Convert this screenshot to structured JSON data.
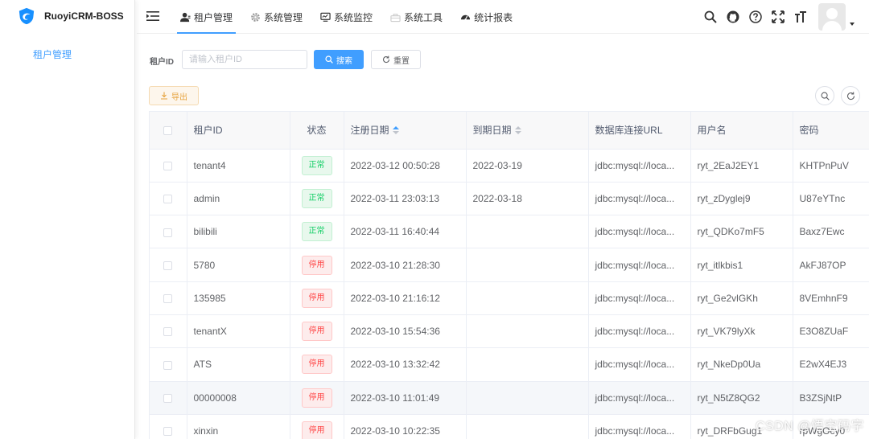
{
  "app": {
    "title": "RuoyiCRM-BOSS",
    "brand_color": "#409eff"
  },
  "sidebar": {
    "items": [
      {
        "label": "租户管理",
        "active": true
      }
    ]
  },
  "topnav": {
    "items": [
      {
        "label": "租户管理",
        "icon": "user-icon",
        "active": true
      },
      {
        "label": "系统管理",
        "icon": "gear-icon",
        "active": false
      },
      {
        "label": "系统监控",
        "icon": "monitor-icon",
        "active": false
      },
      {
        "label": "系统工具",
        "icon": "toolbox-icon",
        "active": false
      },
      {
        "label": "统计报表",
        "icon": "dashboard-icon",
        "active": false
      }
    ],
    "tools": [
      "search-icon",
      "github-icon",
      "question-icon",
      "fullscreen-icon",
      "font-size-icon"
    ]
  },
  "search": {
    "label": "租户ID",
    "placeholder": "请输入租户ID",
    "value": "",
    "search_label": "搜索",
    "reset_label": "重置"
  },
  "toolbar": {
    "export_label": "导出"
  },
  "table": {
    "columns": [
      "租户ID",
      "状态",
      "注册日期",
      "到期日期",
      "数据库连接URL",
      "用户名",
      "密码"
    ],
    "rows": [
      {
        "id": "tenant4",
        "status": "正常",
        "status_type": "ok",
        "reg": "2022-03-12 00:50:28",
        "exp": "2022-03-19",
        "url": "jdbc:mysql://loca...",
        "user": "ryt_2EaJ2EY1",
        "pwd": "KHTPnPuV"
      },
      {
        "id": "admin",
        "status": "正常",
        "status_type": "ok",
        "reg": "2022-03-11 23:03:13",
        "exp": "2022-03-18",
        "url": "jdbc:mysql://loca...",
        "user": "ryt_zDyglej9",
        "pwd": "U87eYTnc"
      },
      {
        "id": "bilibili",
        "status": "正常",
        "status_type": "ok",
        "reg": "2022-03-11 16:40:44",
        "exp": "",
        "url": "jdbc:mysql://loca...",
        "user": "ryt_QDKo7mF5",
        "pwd": "Baxz7Ewc"
      },
      {
        "id": "5780",
        "status": "停用",
        "status_type": "off",
        "reg": "2022-03-10 21:28:30",
        "exp": "",
        "url": "jdbc:mysql://loca...",
        "user": "ryt_itlkbis1",
        "pwd": "AkFJ87OP"
      },
      {
        "id": "135985",
        "status": "停用",
        "status_type": "off",
        "reg": "2022-03-10 21:16:12",
        "exp": "",
        "url": "jdbc:mysql://loca...",
        "user": "ryt_Ge2vlGKh",
        "pwd": "8VEmhnF9"
      },
      {
        "id": "tenantX",
        "status": "停用",
        "status_type": "off",
        "reg": "2022-03-10 15:54:36",
        "exp": "",
        "url": "jdbc:mysql://loca...",
        "user": "ryt_VK79lyXk",
        "pwd": "E3O8ZUaF"
      },
      {
        "id": "ATS",
        "status": "停用",
        "status_type": "off",
        "reg": "2022-03-10 13:32:42",
        "exp": "",
        "url": "jdbc:mysql://loca...",
        "user": "ryt_NkeDp0Ua",
        "pwd": "E2wX4EJ3"
      },
      {
        "id": "00000008",
        "status": "停用",
        "status_type": "off",
        "reg": "2022-03-10 11:01:49",
        "exp": "",
        "url": "jdbc:mysql://loca...",
        "user": "ryt_N5tZ8QG2",
        "pwd": "B3ZSjNtP"
      },
      {
        "id": "xinxin",
        "status": "停用",
        "status_type": "off",
        "reg": "2022-03-10 10:22:35",
        "exp": "",
        "url": "jdbc:mysql://loca...",
        "user": "ryt_DRFbGug1",
        "pwd": "rpWgOcy0"
      }
    ]
  },
  "watermark": "CSDN @悟空码字"
}
